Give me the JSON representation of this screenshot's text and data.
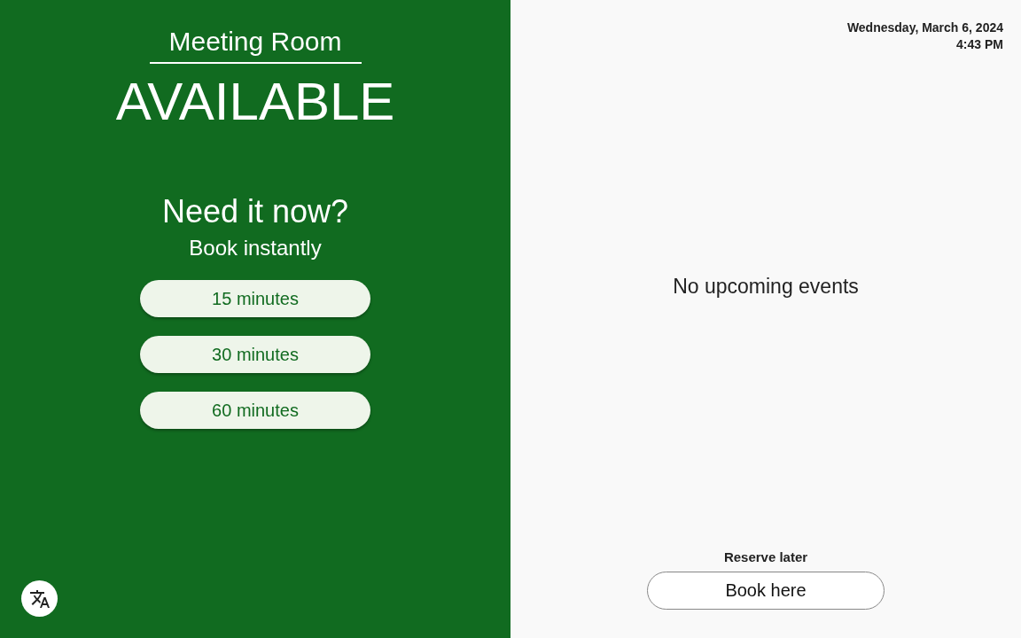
{
  "room": {
    "name": "Meeting Room",
    "status": {
      "kind": "available",
      "label": "AVAILABLE"
    }
  },
  "instant": {
    "title": "Need it now?",
    "subtitle": "Book instantly",
    "options": [
      "15 minutes",
      "30 minutes",
      "60 minutes"
    ]
  },
  "clock": {
    "date": "Wednesday, March 6, 2024",
    "time": "4:43 PM"
  },
  "events": {
    "empty_message": "No upcoming events"
  },
  "reserve": {
    "label": "Reserve later",
    "button": "Book here"
  }
}
